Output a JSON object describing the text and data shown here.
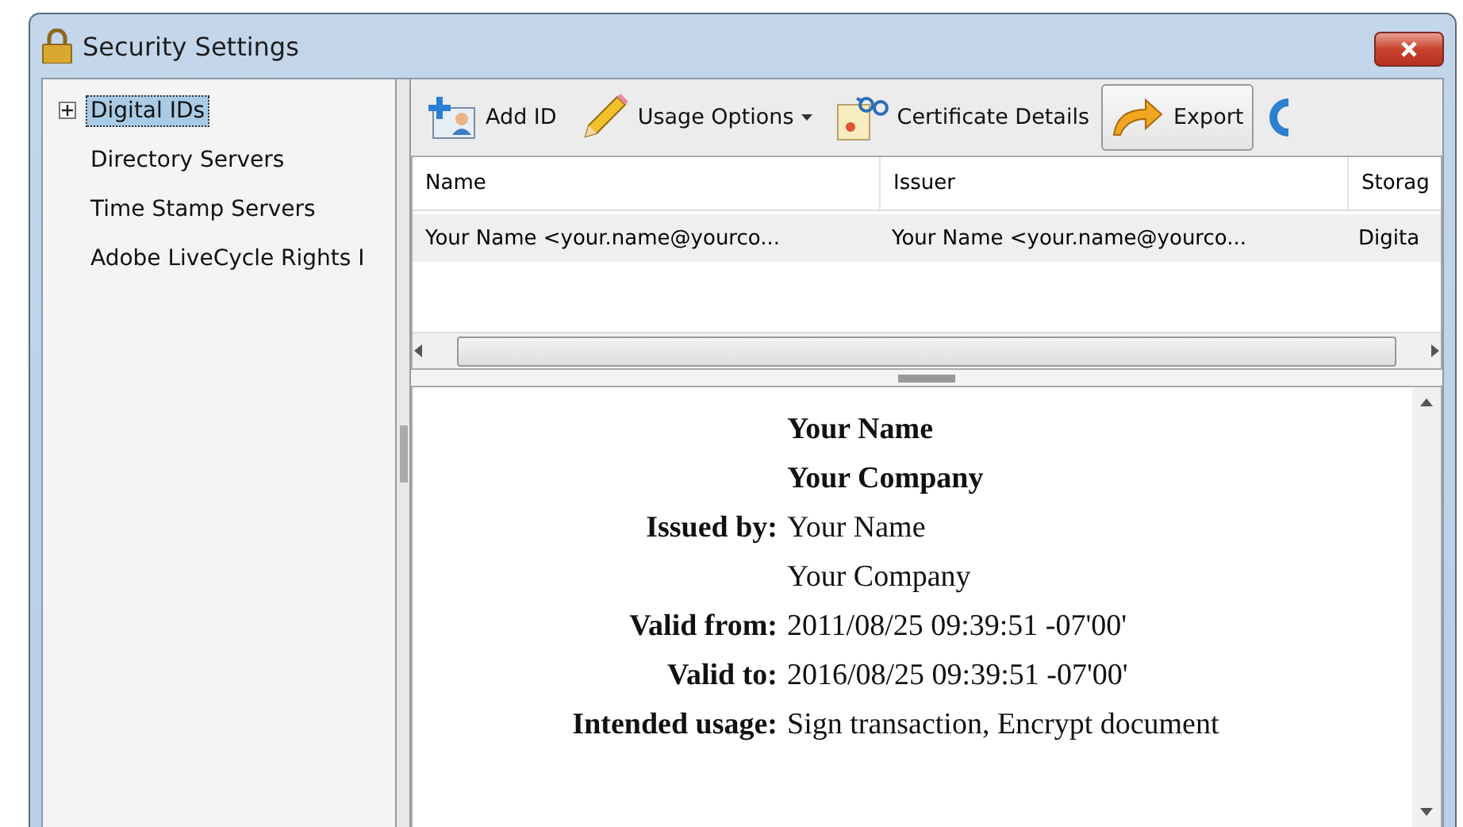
{
  "window": {
    "title": "Security Settings"
  },
  "sidebar": {
    "items": [
      {
        "label": "Digital IDs",
        "selected": true,
        "expanded": false
      },
      {
        "label": "Directory Servers",
        "selected": false
      },
      {
        "label": "Time Stamp Servers",
        "selected": false
      },
      {
        "label": "Adobe LiveCycle Rights I",
        "selected": false
      }
    ]
  },
  "toolbar": [
    {
      "kind": "add",
      "label": "Add ID",
      "highlighted": false
    },
    {
      "kind": "usage",
      "label": "Usage Options",
      "highlighted": false,
      "dropdown": true
    },
    {
      "kind": "details",
      "label": "Certificate Details",
      "highlighted": false
    },
    {
      "kind": "export",
      "label": "Export",
      "highlighted": true
    },
    {
      "kind": "refresh",
      "highlighted": false
    }
  ],
  "table": {
    "columns": [
      "Name",
      "Issuer",
      "Storag"
    ],
    "rows": [
      {
        "selected": true,
        "cells": [
          "Your Name <your.name@yourco...",
          "Your Name <your.name@yourco...",
          "Digita"
        ]
      }
    ]
  },
  "details": [
    {
      "kind": "heading",
      "value": "Your Name"
    },
    {
      "kind": "heading",
      "value": "Your Company"
    },
    {
      "kind": "field",
      "label": "Issued by:",
      "value": "Your Name"
    },
    {
      "kind": "field",
      "value": "Your Company"
    },
    {
      "kind": "field",
      "label": "Valid from:",
      "value": "2011/08/25 09:39:51 -07'00'"
    },
    {
      "kind": "field",
      "label": "Valid to:",
      "value": "2016/08/25 09:39:51 -07'00'"
    },
    {
      "kind": "field",
      "label": "Intended usage:",
      "value": "Sign transaction, Encrypt document"
    }
  ]
}
